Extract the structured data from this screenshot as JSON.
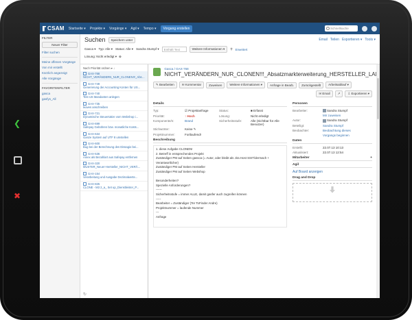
{
  "device": {
    "back_glyph": "❮",
    "close_glyph": "✖"
  },
  "topnav": {
    "logo": "CSAM",
    "items": [
      "Startseite ▾",
      "Projekte ▾",
      "Vorgänge ▾",
      "Agil ▾",
      "Tempo ▾"
    ],
    "create": "Vorgang erstellen",
    "search_placeholder": "Schnellsuche"
  },
  "left": {
    "title": "FILTER",
    "new_filter": "Neuer Filter",
    "find_filters": "Filter suchen",
    "links": [
      "Meine offenen Vorgänge",
      "Von mir erstellt",
      "Kürzlich angezeigt",
      "Alle Vorgänge"
    ],
    "fav_title": "FAVORITENFILTER",
    "favs": [
      "gasca",
      "gasfys_All"
    ]
  },
  "header": {
    "title": "Suchen",
    "save_as": "Speichern unter",
    "email": "Email",
    "share": "Teilen",
    "export": "Exportieren ▾",
    "tools": "Tools ▾"
  },
  "filters": {
    "items": [
      "Gasca ▾",
      "Typ: Alle ▾",
      "Status: Alle ▾",
      "Sandra Stumpf ▾"
    ],
    "text_placeholder": "Enthält Text",
    "more": "Weitere Informationen ▾",
    "advanced": "Erweitert",
    "resolution": "Lösung: Nicht erledigt ▾"
  },
  "list": {
    "sort": "Nach Priorität ordnen ▾ ↓",
    "issues": [
      {
        "key": "GAX-768",
        "summary": "NICHT_VERÄNDERN_NUR_CLONEN!!!_Absatz..."
      },
      {
        "key": "GAX-749",
        "summary": "Generierung der Accounting Konten für US..."
      },
      {
        "key": "GAX-740",
        "summary": "Test US Mandanten anlegen"
      },
      {
        "key": "GAX-735",
        "summary": "leaves anschreiben"
      },
      {
        "key": "GAX-721",
        "summary": "Dynamische Steuersätze vom Webshop i..."
      },
      {
        "key": "GAX-699",
        "summary": "Safepay Gebühren bzw. monatliche Kosts..."
      },
      {
        "key": "GAX-634",
        "summary": "Ganze System auf UTF 8 umstellen"
      },
      {
        "key": "GAX-600",
        "summary": "Bug bei der Berechnung des Dissagio bei..."
      },
      {
        "key": "GAX-536",
        "summary": "Amex als Bezahlart aus Safepay entfernen"
      },
      {
        "key": "GAX-320",
        "summary": "MUSTER_Neuer-Hersteller_NICHT_VERÄ..."
      },
      {
        "key": "GAX-154",
        "summary": "Verarbeitung und Ausgabe Dezimalwerte..."
      },
      {
        "key": "GAX-825",
        "summary": "CLONE - M3 2_a_ Set up_Dienstleister_P..."
      }
    ]
  },
  "detail": {
    "breadcrumb": "Gasca / GAX-768",
    "title": "NICHT_VERÄNDERN_NUR_CLONEN!!!_Absatzmarkterweiterung_HERSTELLER_LAND",
    "actions": [
      "✎ Bearbeiten",
      "✉ Kommentar",
      "Zuweisen",
      "Weitere Informationen ▾",
      "Anfrage in Bearb.",
      "Zurückgestellt",
      "Arbeitsablauf ▾"
    ],
    "actions2": [
      "✉ Email",
      "↗",
      "⇩ Exportieren ▾"
    ],
    "details_title": "Details",
    "fields": [
      [
        "Typ:",
        "☑ Projektanfrage",
        "Status:",
        "■ Erfasst"
      ],
      [
        "Priorität:",
        "↑ Hoch",
        "Lösung:",
        "Nicht erledigt"
      ],
      [
        "Komponente/n:",
        "Brand",
        "Sicherheitsstufe:",
        "Alle (Sichtbar für Alle Benutzer)"
      ],
      [
        "Stichwörter:",
        "Keine ✎",
        "",
        ""
      ],
      [
        "Projektnummer:",
        "Fortlaufend!",
        "",
        ""
      ]
    ],
    "desc_title": "Beschreibung",
    "description": "1. diese Aufgabe CLONEN!\n2. Betreff in entsprechendes Projekt\nZuständiger PM auf Seiten gassca (= Autor, oder bleibt als Jira Host SSIT/dermach + Verantwortlicher)\nZuständiger PM auf Seiten Hersteller\nZuständiger PM auf Seiten Webshop\n\nBesonderheiten?\nSpezielle Anforderungen?\n------\nSicherheitsstufe = immer ALLE, damit gasfer auch zugreifen können\n-----\nBearbeiter = Zuständiger (Ter ToFinder Andre)\nProjektnummer = laufende Nummer\n---\nAnfrage",
    "people_title": "Personen",
    "people": [
      [
        "Bearbeiter:",
        "Sandra Stumpf"
      ],
      [
        "",
        "Mir zuweisen"
      ],
      [
        "Autor:",
        "Sandra Stumpf"
      ],
      [
        "Beteiligt:",
        "Sandra Stumpf"
      ],
      [
        "Beobachter:",
        "Beobachtung dieses"
      ],
      [
        "",
        "Vorgangs beginnen"
      ]
    ],
    "dates_title": "Daten",
    "dates": [
      [
        "Erstellt:",
        "22.07.13 10:13"
      ],
      [
        "Aktualisiert:",
        "22.07.13 12:54"
      ]
    ],
    "team_title": "Mitarbeiter",
    "agil_title": "Agil",
    "agil_link": "Auf Board anzeigen",
    "dnd_title": "Drag and Drop"
  }
}
